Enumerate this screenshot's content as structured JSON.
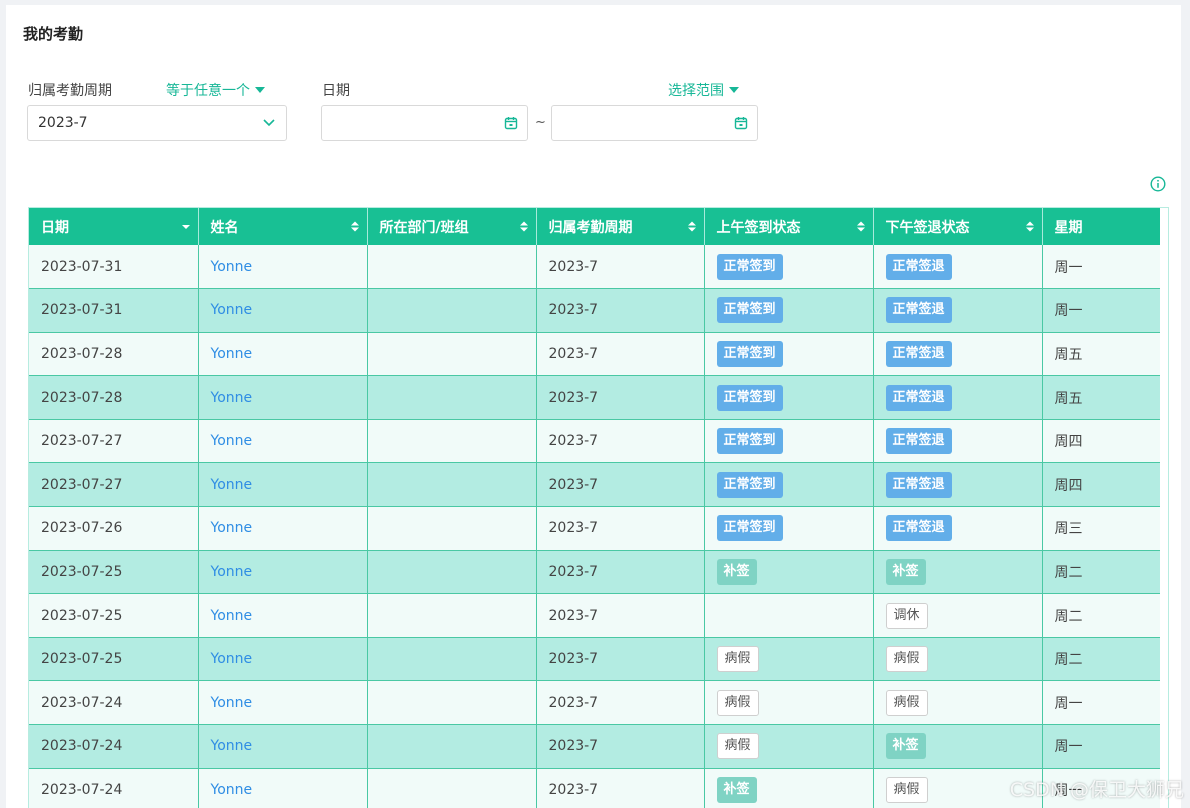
{
  "page_title": "我的考勤",
  "filters": {
    "period_label": "归属考勤周期",
    "period_mode": "等于任意一个",
    "period_value": "2023-7",
    "date_label": "日期",
    "date_mode": "选择范围",
    "date_separator": "~",
    "date_start": "",
    "date_end": ""
  },
  "table": {
    "columns": [
      "日期",
      "姓名",
      "所在部门/班组",
      "归属考勤周期",
      "上午签到状态",
      "下午签退状态",
      "星期"
    ],
    "rows": [
      {
        "date": "2023-07-31",
        "name": "Yonne",
        "dept": "",
        "period": "2023-7",
        "am": "正常签到",
        "am_style": "blue",
        "pm": "正常签退",
        "pm_style": "blue",
        "weekday": "周一"
      },
      {
        "date": "2023-07-31",
        "name": "Yonne",
        "dept": "",
        "period": "2023-7",
        "am": "正常签到",
        "am_style": "blue",
        "pm": "正常签退",
        "pm_style": "blue",
        "weekday": "周一"
      },
      {
        "date": "2023-07-28",
        "name": "Yonne",
        "dept": "",
        "period": "2023-7",
        "am": "正常签到",
        "am_style": "blue",
        "pm": "正常签退",
        "pm_style": "blue",
        "weekday": "周五"
      },
      {
        "date": "2023-07-28",
        "name": "Yonne",
        "dept": "",
        "period": "2023-7",
        "am": "正常签到",
        "am_style": "blue",
        "pm": "正常签退",
        "pm_style": "blue",
        "weekday": "周五"
      },
      {
        "date": "2023-07-27",
        "name": "Yonne",
        "dept": "",
        "period": "2023-7",
        "am": "正常签到",
        "am_style": "blue",
        "pm": "正常签退",
        "pm_style": "blue",
        "weekday": "周四"
      },
      {
        "date": "2023-07-27",
        "name": "Yonne",
        "dept": "",
        "period": "2023-7",
        "am": "正常签到",
        "am_style": "blue",
        "pm": "正常签退",
        "pm_style": "blue",
        "weekday": "周四"
      },
      {
        "date": "2023-07-26",
        "name": "Yonne",
        "dept": "",
        "period": "2023-7",
        "am": "正常签到",
        "am_style": "blue",
        "pm": "正常签退",
        "pm_style": "blue",
        "weekday": "周三"
      },
      {
        "date": "2023-07-25",
        "name": "Yonne",
        "dept": "",
        "period": "2023-7",
        "am": "补签",
        "am_style": "teal",
        "pm": "补签",
        "pm_style": "teal",
        "weekday": "周二"
      },
      {
        "date": "2023-07-25",
        "name": "Yonne",
        "dept": "",
        "period": "2023-7",
        "am": "",
        "am_style": "",
        "pm": "调休",
        "pm_style": "outline",
        "weekday": "周二"
      },
      {
        "date": "2023-07-25",
        "name": "Yonne",
        "dept": "",
        "period": "2023-7",
        "am": "病假",
        "am_style": "outline",
        "pm": "病假",
        "pm_style": "outline",
        "weekday": "周二"
      },
      {
        "date": "2023-07-24",
        "name": "Yonne",
        "dept": "",
        "period": "2023-7",
        "am": "病假",
        "am_style": "outline",
        "pm": "病假",
        "pm_style": "outline",
        "weekday": "周一"
      },
      {
        "date": "2023-07-24",
        "name": "Yonne",
        "dept": "",
        "period": "2023-7",
        "am": "病假",
        "am_style": "outline",
        "pm": "补签",
        "pm_style": "teal",
        "weekday": "周一"
      },
      {
        "date": "2023-07-24",
        "name": "Yonne",
        "dept": "",
        "period": "2023-7",
        "am": "补签",
        "am_style": "teal",
        "pm": "病假",
        "pm_style": "outline",
        "weekday": "周一"
      }
    ]
  },
  "icons": {
    "info": "info-circle-icon",
    "calendar": "calendar-icon",
    "chevron": "chevron-down-icon",
    "sort": "sort-icon",
    "sort_desc": "sort-desc-icon"
  },
  "colors": {
    "accent": "#18c094",
    "row_alt": "#b3ece2",
    "tag_blue": "#62aee9",
    "tag_teal": "#7fd3c4",
    "link": "#2f8de4"
  },
  "watermark": "CSDN @保卫大狮兄"
}
